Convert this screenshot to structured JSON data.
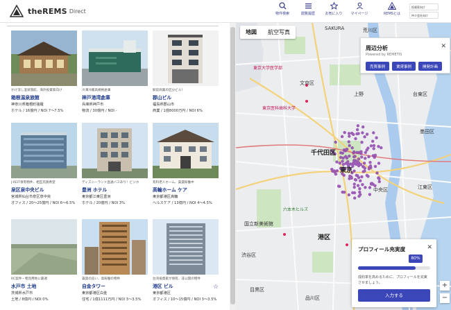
{
  "header": {
    "logo_text": "theREMS",
    "logo_sub": "Direct",
    "nav": [
      {
        "label": "物件検索",
        "icon": "search-icon"
      },
      {
        "label": "閲覧履歴",
        "icon": "history-icon"
      },
      {
        "label": "お気に入り",
        "icon": "star-icon"
      },
      {
        "label": "マイページ",
        "icon": "user-icon"
      },
      {
        "label": "REMSとは",
        "icon": "rems-logo-icon"
      }
    ],
    "links": [
      "投資家向け",
      "仲介会社向け"
    ]
  },
  "listings": [
    {
      "tag": "かけ流し温泉旅館、海外投資家向け",
      "title": "箱根温泉旅館",
      "location": "神奈川県箱根町強羅",
      "spec": "ホテル / 16億円 / NOI 7～7.5%"
    },
    {
      "tag": "冷凍冷蔵高規格倉庫",
      "title": "神戸港湾倉庫",
      "location": "兵庫県神戸市",
      "spec": "物流 / 30億円 / NOI -"
    },
    {
      "tag": "駅前商業の区分ビル！",
      "title": "郡山ビル",
      "location": "福島県郡山市",
      "spec": "商業 / 1億8000万円 / NOI 6%"
    },
    {
      "tag": "J-REIT保有物件、相互売買希望",
      "title": "泉区泉中央ビル",
      "location": "宮城県仙台市泉区泉中央",
      "spec": "オフィス / 20～25億円 / NOI 6～6.5%"
    },
    {
      "tag": "ディズニーランド直通バスあり！ビジホ",
      "title": "豊洲 ホテル",
      "location": "東京都江東区豊洲",
      "spec": "ホテル / 20億円 / NOI 3%"
    },
    {
      "tag": "有料老人ホーム、賃貸稼働中",
      "title": "高輪ホーム ケア",
      "location": "東京都港区高輪",
      "spec": "ヘルスケア / 13億円 / NOI 4～4.5%"
    },
    {
      "tag": "RC案件・物流用地に最適",
      "title": "水戸市 土地",
      "location": "茨城県水戸市",
      "spec": "土地 / 8億円 / NOI 0%"
    },
    {
      "tag": "賃貸の良い、高稼働の物件",
      "title": "自金タワー",
      "location": "東京都港区白金",
      "spec": "住宅 / 1億1111万円 / NOI 3～3.5%"
    },
    {
      "tag": "台湾投資家が保有、非公開の物件",
      "title": "港区 ビル",
      "location": "東京都港区",
      "spec": "オフィス / 10～15億円 / NOI 3～3.5%"
    }
  ],
  "map": {
    "tabs": [
      "地図",
      "航空写真"
    ],
    "labels": {
      "arakawa": "荒川区",
      "bunkyo": "文京区",
      "taito": "台東区",
      "chiyoda": "千代田区",
      "tokyo": "東京",
      "chuo": "中央区",
      "minato": "港区",
      "shibuya": "渋谷区",
      "meguro": "目黒区",
      "sumida": "墨田区",
      "koto": "江東区",
      "shinagawa": "品川区",
      "ueno": "上野",
      "university": "東京医科歯科大学",
      "roppongi": "六本木ヒルズ",
      "park": "国立新美術館",
      "hospital": "東京大学医学部",
      "sakura": "SAKURA"
    }
  },
  "analysis": {
    "title": "周辺分析",
    "subtitle": "Powered by REMETIS",
    "buttons": [
      "売買事例",
      "賃貸事例",
      "開発計画"
    ]
  },
  "profile": {
    "title": "プロフィール充実度",
    "percent_label": "80%",
    "percent": 80,
    "text": "成約率を高めるために、プロフィールを充実させましょう。",
    "button": "入力する"
  },
  "colors": {
    "accent": "#3b46b8",
    "title": "#1f3a8a",
    "marker": "#8e44ad"
  }
}
